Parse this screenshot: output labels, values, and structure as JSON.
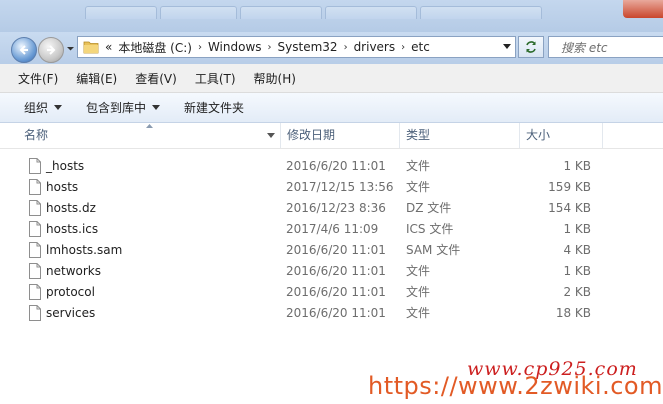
{
  "address": {
    "crumbs": [
      "«",
      "本地磁盘 (C:)",
      "Windows",
      "System32",
      "drivers",
      "etc"
    ],
    "separator": "›"
  },
  "search": {
    "placeholder": "搜索 etc"
  },
  "menu": [
    "文件(F)",
    "编辑(E)",
    "查看(V)",
    "工具(T)",
    "帮助(H)"
  ],
  "toolbar": {
    "organize": "组织",
    "include_in_library": "包含到库中",
    "new_folder": "新建文件夹"
  },
  "columns": {
    "name": "名称",
    "modified": "修改日期",
    "type": "类型",
    "size": "大小"
  },
  "files": [
    {
      "name": "_hosts",
      "modified": "2016/6/20 11:01",
      "type": "文件",
      "size": "1 KB"
    },
    {
      "name": "hosts",
      "modified": "2017/12/15 13:56",
      "type": "文件",
      "size": "159 KB"
    },
    {
      "name": "hosts.dz",
      "modified": "2016/12/23 8:36",
      "type": "DZ 文件",
      "size": "154 KB"
    },
    {
      "name": "hosts.ics",
      "modified": "2017/4/6 11:09",
      "type": "ICS 文件",
      "size": "1 KB"
    },
    {
      "name": "lmhosts.sam",
      "modified": "2016/6/20 11:01",
      "type": "SAM 文件",
      "size": "4 KB"
    },
    {
      "name": "networks",
      "modified": "2016/6/20 11:01",
      "type": "文件",
      "size": "1 KB"
    },
    {
      "name": "protocol",
      "modified": "2016/6/20 11:01",
      "type": "文件",
      "size": "2 KB"
    },
    {
      "name": "services",
      "modified": "2016/6/20 11:01",
      "type": "文件",
      "size": "18 KB"
    }
  ],
  "watermark": {
    "title": "www.cp925.com",
    "url": "https://www.2zwiki.com"
  },
  "colors": {
    "titlebar": "#b9cee8",
    "accent": "#2f66b3",
    "watermark": "#e25a25"
  }
}
